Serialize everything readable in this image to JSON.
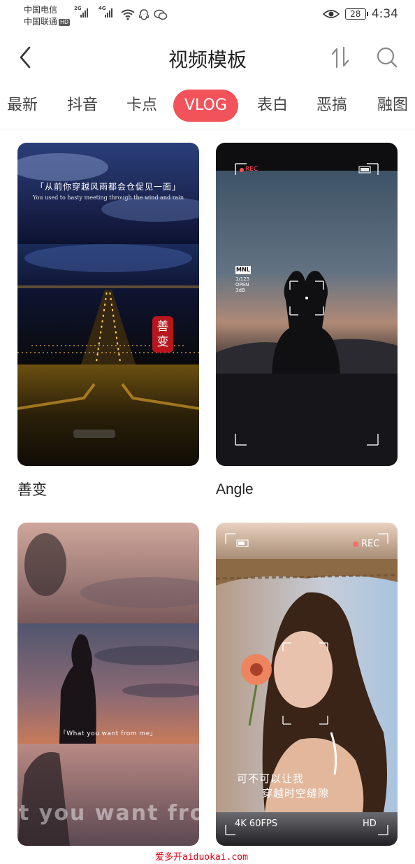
{
  "status_bar": {
    "carrier_1": "中国电信",
    "carrier_2": "中国联通",
    "carrier_2_badge": "HD",
    "network_1": "2G",
    "network_2": "4G",
    "battery": "28",
    "time": "4:34"
  },
  "header": {
    "title": "视频模板",
    "icons": [
      "back-arrow-icon",
      "sort-icon",
      "search-icon"
    ]
  },
  "tabs": [
    {
      "label": "最新",
      "active": false
    },
    {
      "label": "抖音",
      "active": false
    },
    {
      "label": "卡点",
      "active": false
    },
    {
      "label": "VLOG",
      "active": true
    },
    {
      "label": "表白",
      "active": false
    },
    {
      "label": "恶搞",
      "active": false
    },
    {
      "label": "融图",
      "active": false
    }
  ],
  "colors": {
    "accent": "#f2535b",
    "rec_red": "#ff4d4f",
    "watermark_red": "#e60012"
  },
  "templates": [
    {
      "name": "善变",
      "overlay": {
        "quote_cn": "「从前你穿越风雨都会仓促见一面」",
        "quote_en": "You used to hasty meeting through the wind and rain",
        "seal": "善变"
      }
    },
    {
      "name": "Angle",
      "overlay": {
        "rec": "REC",
        "mode": "MNL",
        "shutter": "1/125",
        "aperture": "OPEN",
        "gain": "3dB"
      }
    },
    {
      "name": "",
      "overlay": {
        "caption": "「What you want from me」",
        "big_text": "t you want from"
      }
    },
    {
      "name": "",
      "overlay": {
        "rec": "REC",
        "line_1": "可不可以让我",
        "line_2": "穿越时空缝隙",
        "format": "4K 60FPS",
        "quality": "HD"
      }
    }
  ],
  "watermark": "爱多开aiduokai.com"
}
